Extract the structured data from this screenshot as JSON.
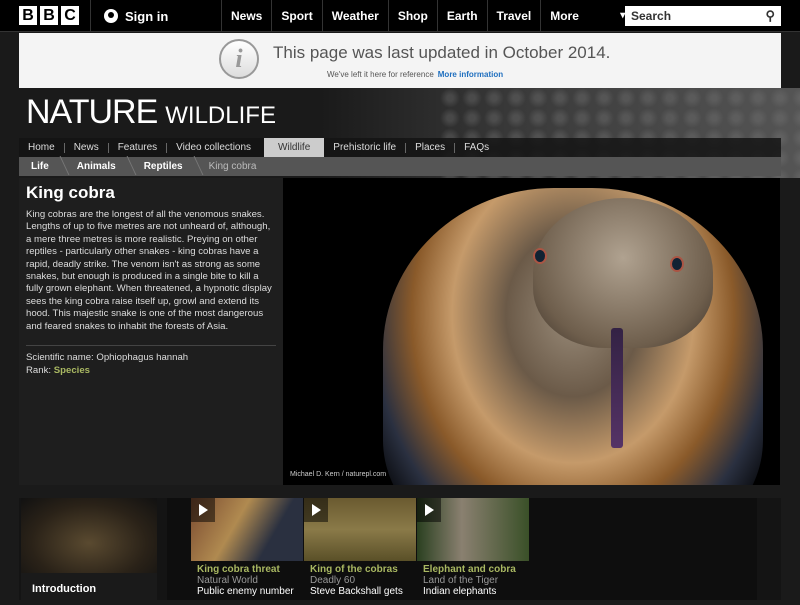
{
  "bbc": {
    "logo": [
      "B",
      "B",
      "C"
    ],
    "signin": "Sign in",
    "nav": [
      "News",
      "Sport",
      "Weather",
      "Shop",
      "Earth",
      "Travel",
      "More"
    ],
    "search_placeholder": "Search"
  },
  "banner": {
    "title": "This page was last updated in October 2014.",
    "sub": "We've left it here for reference",
    "link": "More information"
  },
  "header": {
    "title": "NATURE",
    "subtitle": "WILDLIFE"
  },
  "secnav": [
    "Home",
    "News",
    "Features",
    "Video collections",
    "Wildlife",
    "Prehistoric life",
    "Places",
    "FAQs"
  ],
  "breadcrumb": [
    "Life",
    "Animals",
    "Reptiles",
    "King cobra"
  ],
  "article": {
    "title": "King cobra",
    "body": "King cobras are the longest of all the venomous snakes. Lengths of up to five metres are not unheard of, although, a mere three metres is more realistic. Preying on other reptiles - particularly other snakes - king cobras have a rapid, deadly strike. The venom isn't as strong as some snakes, but enough is produced in a single bite to kill a fully grown elephant. When threatened, a hypnotic display sees the king cobra raise itself up, growl and extend its hood. This majestic snake is one of the most dangerous and feared snakes to inhabit the forests of Asia.",
    "sci_label": "Scientific name: Ophiophagus hannah",
    "rank_label": "Rank: ",
    "rank": "Species"
  },
  "photo_credit": "Michael D. Kern / naturepl.com",
  "intro": "Introduction",
  "clips": [
    {
      "title": "King cobra threat",
      "source": "Natural World",
      "desc": "Public enemy number"
    },
    {
      "title": "King of the cobras",
      "source": "Deadly 60",
      "desc": "Steve Backshall gets"
    },
    {
      "title": "Elephant and cobra",
      "source": "Land of the Tiger",
      "desc": "Indian elephants"
    }
  ]
}
